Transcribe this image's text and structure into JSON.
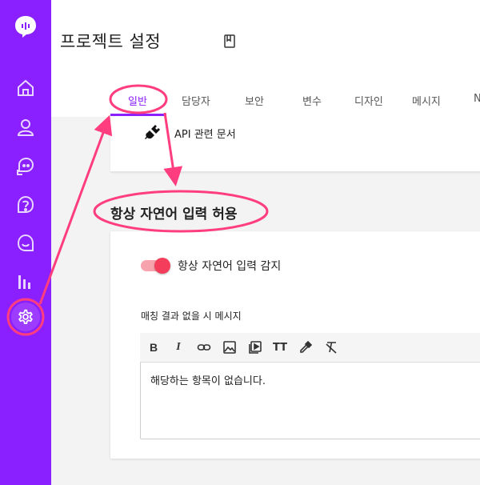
{
  "header": {
    "title": "프로젝트 설정"
  },
  "tabs": [
    {
      "label": "일반",
      "active": true
    },
    {
      "label": "담당자"
    },
    {
      "label": "보안"
    },
    {
      "label": "변수"
    },
    {
      "label": "디자인"
    },
    {
      "label": "메시지"
    },
    {
      "label": "N"
    }
  ],
  "api_link": {
    "label": "API 관련 문서"
  },
  "section": {
    "title": "항상 자연어 입력 허용",
    "toggle_label": "항상 자연어 입력 감지",
    "toggle_on": true,
    "field_label": "매칭 결과 없을 시 메시지",
    "editor_value": "해당하는 항목이 없습니다."
  },
  "editor_toolbar": [
    "bold-icon",
    "italic-icon",
    "link-icon",
    "image-icon",
    "video-icon",
    "text-size-icon",
    "color-picker-icon",
    "clear-format-icon"
  ],
  "colors": {
    "accent": "#8a1fff",
    "annotation": "#ff3d7f",
    "toggle": "#f43d5a"
  }
}
